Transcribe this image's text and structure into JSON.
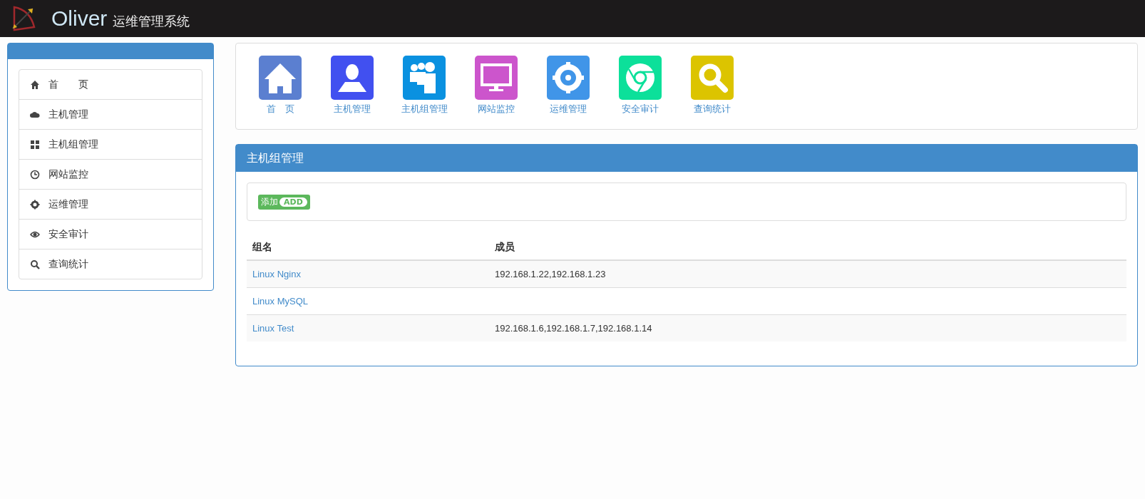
{
  "header": {
    "brand": "Oliver",
    "subtitle": "运维管理系统"
  },
  "sidebar": {
    "items": [
      {
        "label": "首　　页"
      },
      {
        "label": "主机管理"
      },
      {
        "label": "主机组管理"
      },
      {
        "label": "网站监控"
      },
      {
        "label": "运维管理"
      },
      {
        "label": "安全审计"
      },
      {
        "label": "查询统计"
      }
    ]
  },
  "launcher": [
    {
      "label": "首　页",
      "color": "#5b7fd0"
    },
    {
      "label": "主机管理",
      "color": "#4150f0"
    },
    {
      "label": "主机组管理",
      "color": "#0a91e0"
    },
    {
      "label": "网站监控",
      "color": "#cc55cc"
    },
    {
      "label": "运维管理",
      "color": "#4095e8"
    },
    {
      "label": "安全审计",
      "color": "#0ce09a"
    },
    {
      "label": "查询统计",
      "color": "#dcc400"
    }
  ],
  "panel": {
    "title": "主机组管理",
    "add_button": {
      "label": "添加",
      "badge": "ADD"
    },
    "table": {
      "columns": [
        "组名",
        "成员"
      ],
      "rows": [
        {
          "name": "Linux Nginx",
          "members": "192.168.1.22,192.168.1.23"
        },
        {
          "name": "Linux MySQL"
        },
        {
          "name": "Linux Test",
          "members": "192.168.1.6,192.168.1.7,192.168.1.14"
        }
      ]
    }
  }
}
